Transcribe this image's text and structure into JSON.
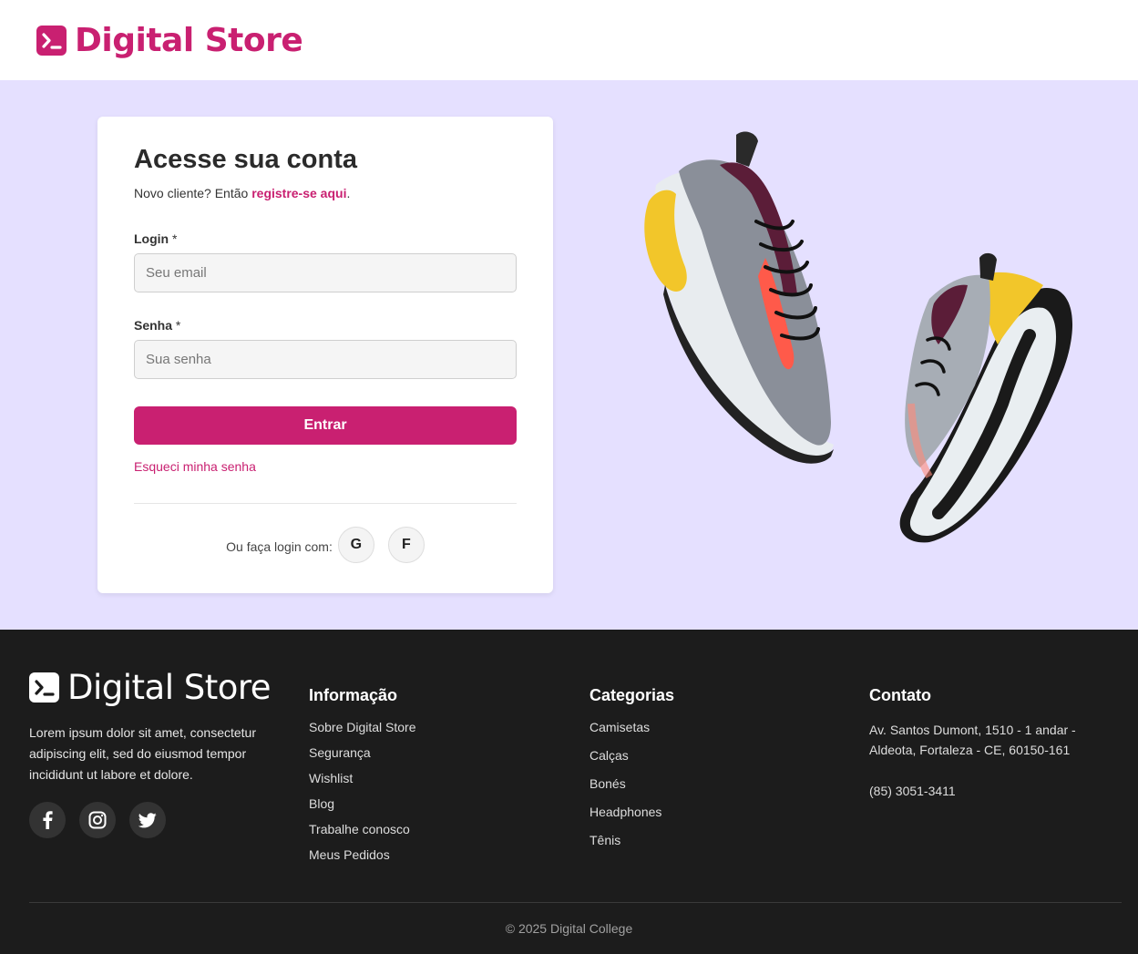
{
  "colors": {
    "brand": "#c92071",
    "hero_bg": "#e5e0ff",
    "footer_bg": "#1c1c1c"
  },
  "header": {
    "brand_name": "Digital Store",
    "brand_icon": "terminal-icon"
  },
  "login": {
    "title": "Acesse sua conta",
    "subtitle_prefix": "Novo cliente? Então ",
    "register_link": "registre-se aqui",
    "subtitle_suffix": ".",
    "login_label": "Login",
    "login_required": "*",
    "login_placeholder": "Seu email",
    "password_label": "Senha",
    "password_required": "*",
    "password_placeholder": "Sua senha",
    "submit_label": "Entrar",
    "forgot_link": "Esqueci minha senha",
    "social_label": "Ou faça login com:",
    "google_label": "G",
    "facebook_label": "F"
  },
  "footer": {
    "brand_name": "Digital Store",
    "description": "Lorem ipsum dolor sit amet, consectetur adipiscing elit, sed do eiusmod tempor incididunt ut labore et dolore.",
    "social_icons": [
      "facebook-icon",
      "instagram-icon",
      "twitter-icon"
    ],
    "info": {
      "title": "Informação",
      "links": [
        "Sobre Digital Store",
        "Segurança",
        "Wishlist",
        "Blog",
        "Trabalhe conosco",
        "Meus Pedidos"
      ]
    },
    "categories": {
      "title": "Categorias",
      "links": [
        "Camisetas",
        "Calças",
        "Bonés",
        "Headphones",
        "Tênis"
      ]
    },
    "contact": {
      "title": "Contato",
      "address": "Av. Santos Dumont, 1510 - 1 andar - Aldeota, Fortaleza - CE, 60150-161",
      "phone": "(85) 3051-3411"
    },
    "copyright": "© 2025 Digital College"
  }
}
